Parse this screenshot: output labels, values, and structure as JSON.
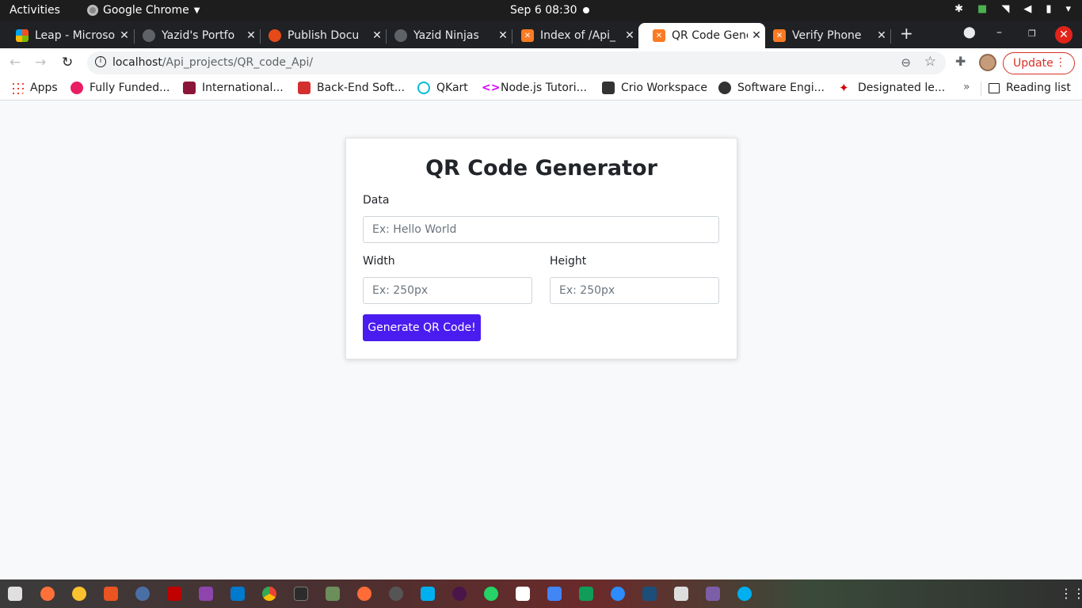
{
  "system": {
    "activities": "Activities",
    "app_name": "Google Chrome",
    "clock": "Sep 6  08:30"
  },
  "tabs": [
    {
      "label": "Leap - Microso",
      "color": "#f25022"
    },
    {
      "label": "Yazid's Portfo",
      "color": "#5f6368"
    },
    {
      "label": "Publish Docu",
      "color": "#e64a19"
    },
    {
      "label": "Yazid Ninjas",
      "color": "#5f6368"
    },
    {
      "label": "Index of /Api_",
      "color": "#fb7a24"
    },
    {
      "label": "QR Code Gene",
      "color": "#fb7a24",
      "active": true
    },
    {
      "label": "Verify Phone",
      "color": "#fb7a24"
    }
  ],
  "address": {
    "host": "localhost",
    "path": "/Api_projects/QR_code_Api/",
    "update_label": "Update"
  },
  "bookmarks": [
    {
      "label": "Apps",
      "color": "#4285f4"
    },
    {
      "label": "Fully Funded...",
      "color": "#e91e63"
    },
    {
      "label": "International...",
      "color": "#8b1538"
    },
    {
      "label": "Back-End Soft...",
      "color": "#d32f2f"
    },
    {
      "label": "QKart",
      "color": "#00bcd4"
    },
    {
      "label": "Node.js Tutori...",
      "color": "#d500f9"
    },
    {
      "label": "Crio Workspace",
      "color": "#333333"
    },
    {
      "label": "Software Engi...",
      "color": "#333333"
    },
    {
      "label": "Designated le...",
      "color": "#d50000"
    }
  ],
  "reading_list": "Reading list",
  "form": {
    "title": "QR Code Generator",
    "data_label": "Data",
    "data_placeholder": "Ex: Hello World",
    "width_label": "Width",
    "width_placeholder": "Ex: 250px",
    "height_label": "Height",
    "height_placeholder": "Ex: 250px",
    "submit_label": "Generate QR Code!"
  }
}
